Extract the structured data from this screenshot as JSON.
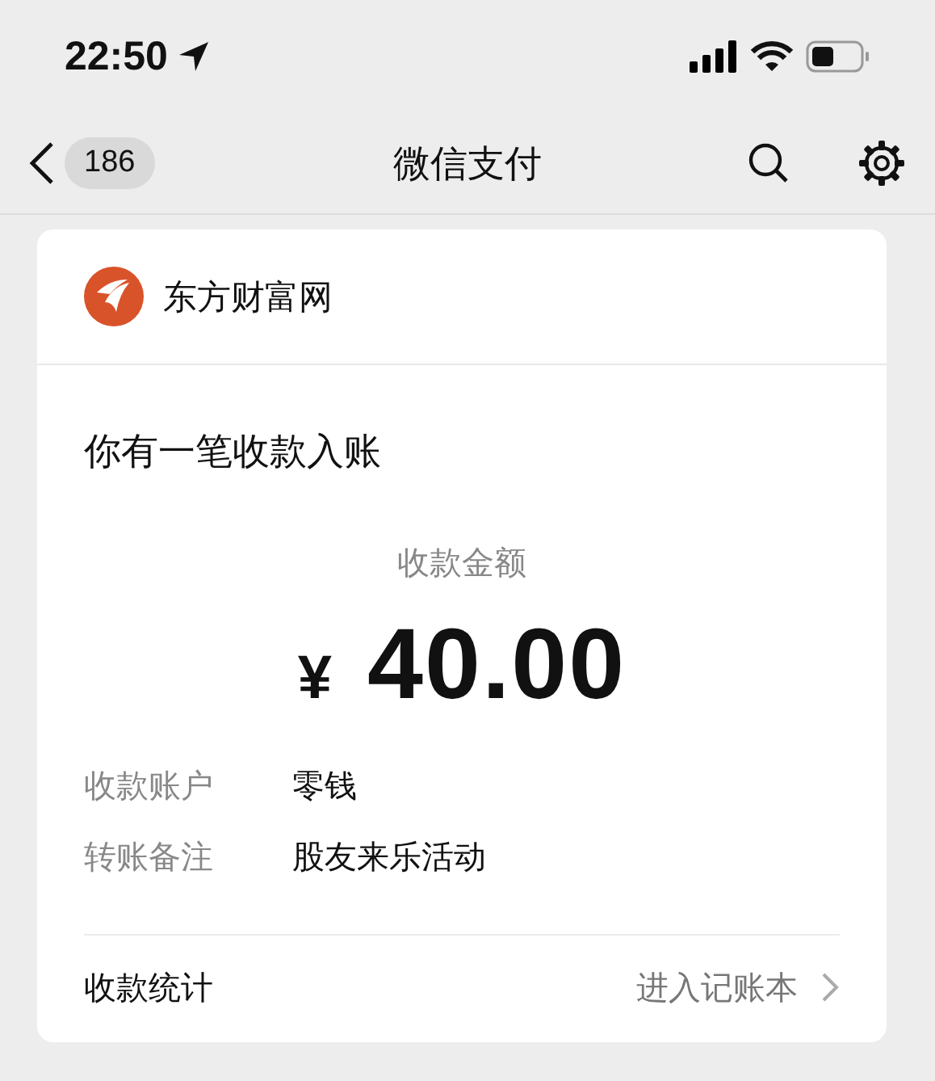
{
  "status_bar": {
    "time": "22:50"
  },
  "nav_bar": {
    "back_count": "186",
    "title": "微信支付"
  },
  "card": {
    "merchant": "东方财富网",
    "heading": "你有一笔收款入账",
    "amount_label": "收款金额",
    "currency": "¥",
    "amount": "40.00",
    "details": [
      {
        "label": "收款账户",
        "value": "零钱"
      },
      {
        "label": "转账备注",
        "value": "股友来乐活动"
      }
    ],
    "footer": {
      "label": "收款统计",
      "link": "进入记账本"
    }
  }
}
